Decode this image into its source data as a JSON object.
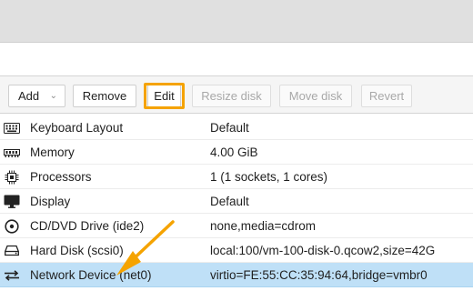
{
  "toolbar": {
    "add_label": "Add",
    "remove_label": "Remove",
    "edit_label": "Edit",
    "resize_label": "Resize disk",
    "move_label": "Move disk",
    "revert_label": "Revert"
  },
  "hardware": [
    {
      "name": "Keyboard Layout",
      "value": "Default",
      "icon": "keyboard-icon"
    },
    {
      "name": "Memory",
      "value": "4.00 GiB",
      "icon": "memory-icon"
    },
    {
      "name": "Processors",
      "value": "1 (1 sockets, 1 cores)",
      "icon": "cpu-icon"
    },
    {
      "name": "Display",
      "value": "Default",
      "icon": "monitor-icon"
    },
    {
      "name": "CD/DVD Drive (ide2)",
      "value": "none,media=cdrom",
      "icon": "disc-icon"
    },
    {
      "name": "Hard Disk (scsi0)",
      "value": "local:100/vm-100-disk-0.qcow2,size=42G",
      "icon": "hard-disk-icon"
    },
    {
      "name": "Network Device (net0)",
      "value": "virtio=FE:55:CC:35:94:64,bridge=vmbr0",
      "icon": "network-icon"
    }
  ],
  "selected_row": "Network Device (net0)",
  "colors": {
    "highlight": "#f5a300",
    "selected_row": "#bfe0f7"
  }
}
